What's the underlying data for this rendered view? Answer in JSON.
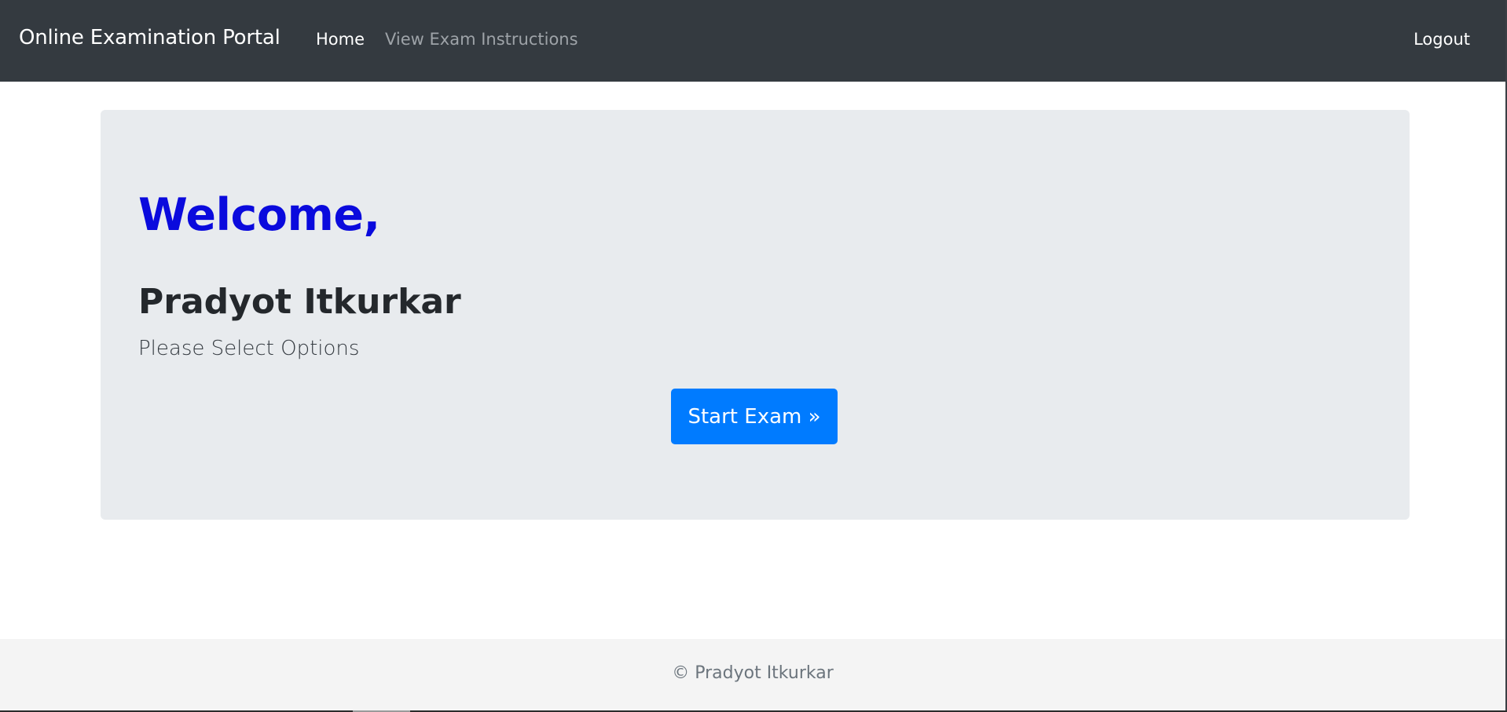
{
  "navbar": {
    "brand": "Online Examination Portal",
    "links": [
      {
        "label": "Home",
        "active": true
      },
      {
        "label": "View Exam Instructions",
        "active": false
      }
    ],
    "logout_label": "Logout"
  },
  "jumbotron": {
    "welcome": "Welcome,",
    "user_name": "Pradyot Itkurkar",
    "subtitle": "Please Select Options",
    "start_button_label": "Start Exam »"
  },
  "footer": {
    "copyright": "© Pradyot Itkurkar"
  },
  "colors": {
    "navbar_bg": "#343a40",
    "welcome_text": "#0a0add",
    "primary_button": "#007bff",
    "jumbotron_bg": "#e8ebee",
    "footer_bg": "#f4f4f4"
  }
}
